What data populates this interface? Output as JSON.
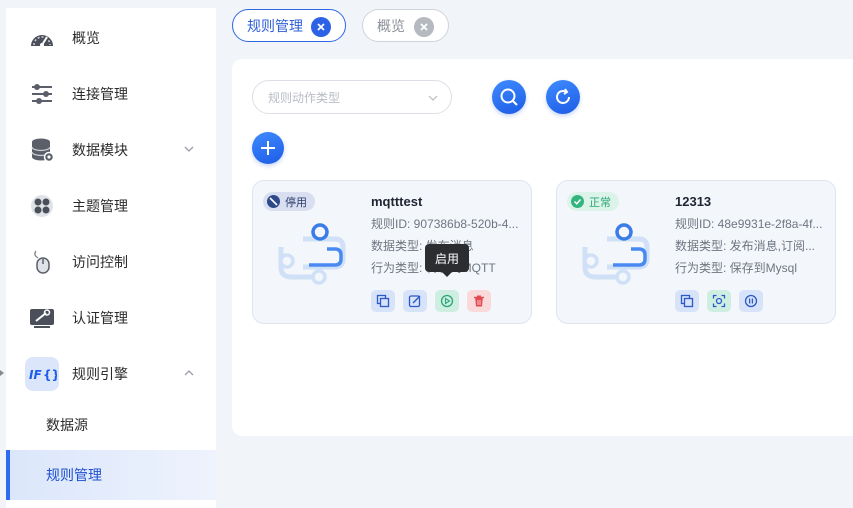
{
  "sidebar": {
    "items": [
      {
        "label": "概览",
        "icon": "dashboard-gauge-icon"
      },
      {
        "label": "连接管理",
        "icon": "connection-sliders-icon"
      },
      {
        "label": "数据模块",
        "icon": "database-icon"
      },
      {
        "label": "主题管理",
        "icon": "topic-grid-icon"
      },
      {
        "label": "访问控制",
        "icon": "mouse-access-icon"
      },
      {
        "label": "认证管理",
        "icon": "auth-tools-icon"
      },
      {
        "label": "规则引擎",
        "icon": "rule-engine-icon"
      }
    ],
    "sub_items": [
      {
        "label": "数据源"
      },
      {
        "label": "规则管理"
      }
    ]
  },
  "tabs": [
    {
      "label": "规则管理",
      "active": true
    },
    {
      "label": "概览",
      "active": false
    }
  ],
  "filter": {
    "placeholder": "规则动作类型"
  },
  "cards": [
    {
      "status": "停用",
      "title": "mqtttest",
      "rule_id": "规则ID: 907386b8-520b-4...",
      "data_type": "数据类型: 发布消息",
      "action_type": "行为类型: 转发到MQTT"
    },
    {
      "status": "正常",
      "title": "12313",
      "rule_id": "规则ID: 48e9931e-2f8a-4f...",
      "data_type": "数据类型: 发布消息,订阅...",
      "action_type": "行为类型: 保存到Mysql"
    }
  ],
  "tooltip": {
    "text": "启用"
  },
  "colors": {
    "primary": "#2c63e6",
    "danger": "#e24b4f",
    "success": "#34b47e"
  }
}
